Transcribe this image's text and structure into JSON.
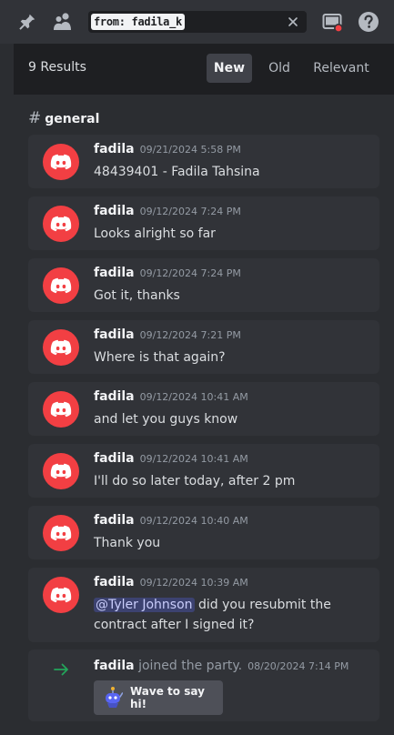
{
  "toolbar": {
    "icons": [
      "pin-icon",
      "members-icon",
      "inbox-icon",
      "help-icon"
    ],
    "search_value": "from: fadila_k"
  },
  "results": {
    "count_label": "9 Results",
    "sort": {
      "new": "New",
      "old": "Old",
      "relevant": "Relevant",
      "selected": "New"
    }
  },
  "channel": {
    "hash": "#",
    "name": "general"
  },
  "messages": [
    {
      "author": "fadila",
      "timestamp": "09/21/2024 5:58 PM",
      "text": "48439401 - Fadila Tahsina"
    },
    {
      "author": "fadila",
      "timestamp": "09/12/2024 7:24 PM",
      "text": "Looks alright so far"
    },
    {
      "author": "fadila",
      "timestamp": "09/12/2024 7:24 PM",
      "text": "Got it, thanks"
    },
    {
      "author": "fadila",
      "timestamp": "09/12/2024 7:21 PM",
      "text": "Where is that again?"
    },
    {
      "author": "fadila",
      "timestamp": "09/12/2024 10:41 AM",
      "text": "and let you guys know"
    },
    {
      "author": "fadila",
      "timestamp": "09/12/2024 10:41 AM",
      "text": "I'll do so later today, after 2 pm"
    },
    {
      "author": "fadila",
      "timestamp": "09/12/2024 10:40 AM",
      "text": "Thank you"
    },
    {
      "author": "fadila",
      "timestamp": "09/12/2024 10:39 AM",
      "mention": "@Tyler Johnson",
      "text": " did you resubmit the contract after I signed it?"
    }
  ],
  "join": {
    "author": "fadila",
    "text": "joined the party.",
    "timestamp": "08/20/2024 7:14 PM",
    "wave_label": "Wave to say hi!"
  },
  "colors": {
    "accent_red": "#f23f43",
    "join_green": "#23a55a",
    "mention_bg": "#3c4270"
  }
}
